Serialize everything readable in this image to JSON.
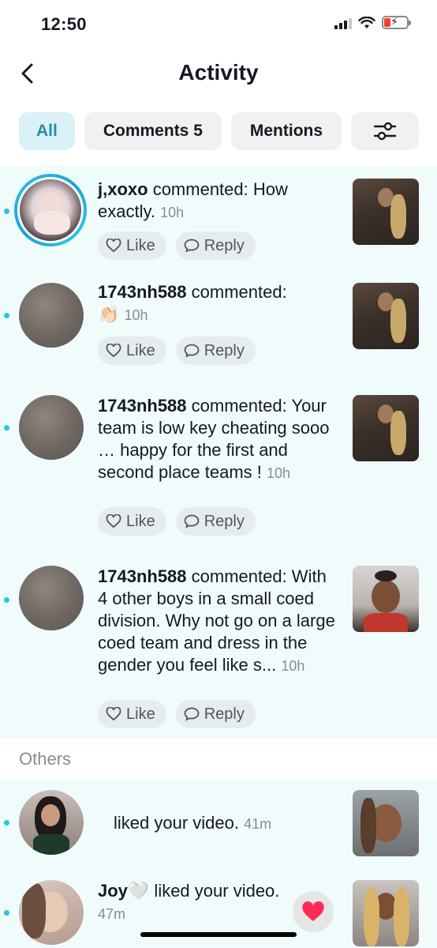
{
  "status_bar": {
    "time": "12:50"
  },
  "header": {
    "title": "Activity"
  },
  "filters": [
    {
      "label": "All"
    },
    {
      "label": "Comments 5"
    },
    {
      "label": "Mentions"
    }
  ],
  "notifications": [
    {
      "username": "j,xoxo",
      "action": " commented: How exactly.",
      "emoji": "",
      "time": "10h",
      "like_label": "Like",
      "reply_label": "Reply"
    },
    {
      "username": "1743nh588",
      "action": " commented:",
      "emoji": "👏🏻",
      "time": "10h",
      "like_label": "Like",
      "reply_label": "Reply"
    },
    {
      "username": "1743nh588",
      "action": " commented: Your team is low key cheating sooo … happy for the first and second place teams !",
      "emoji": "",
      "time": "10h",
      "like_label": "Like",
      "reply_label": "Reply"
    },
    {
      "username": "1743nh588",
      "action": " commented: With 4 other boys in a small coed division. Why not go on a large coed team and dress in the gender you feel like s...",
      "emoji": "",
      "time": "10h",
      "like_label": "Like",
      "reply_label": "Reply"
    }
  ],
  "section_others": {
    "title": "Others",
    "items": [
      {
        "username": "",
        "action": "liked your video.",
        "time": "41m"
      },
      {
        "username": "Joy🤍",
        "action": " liked your video.",
        "time": "47m"
      }
    ]
  },
  "colors": {
    "accent": "#2bc4e2",
    "active_chip_bg": "#d9f1f7",
    "active_chip_text": "#2a8ea6",
    "heart": "#fe2c55"
  }
}
